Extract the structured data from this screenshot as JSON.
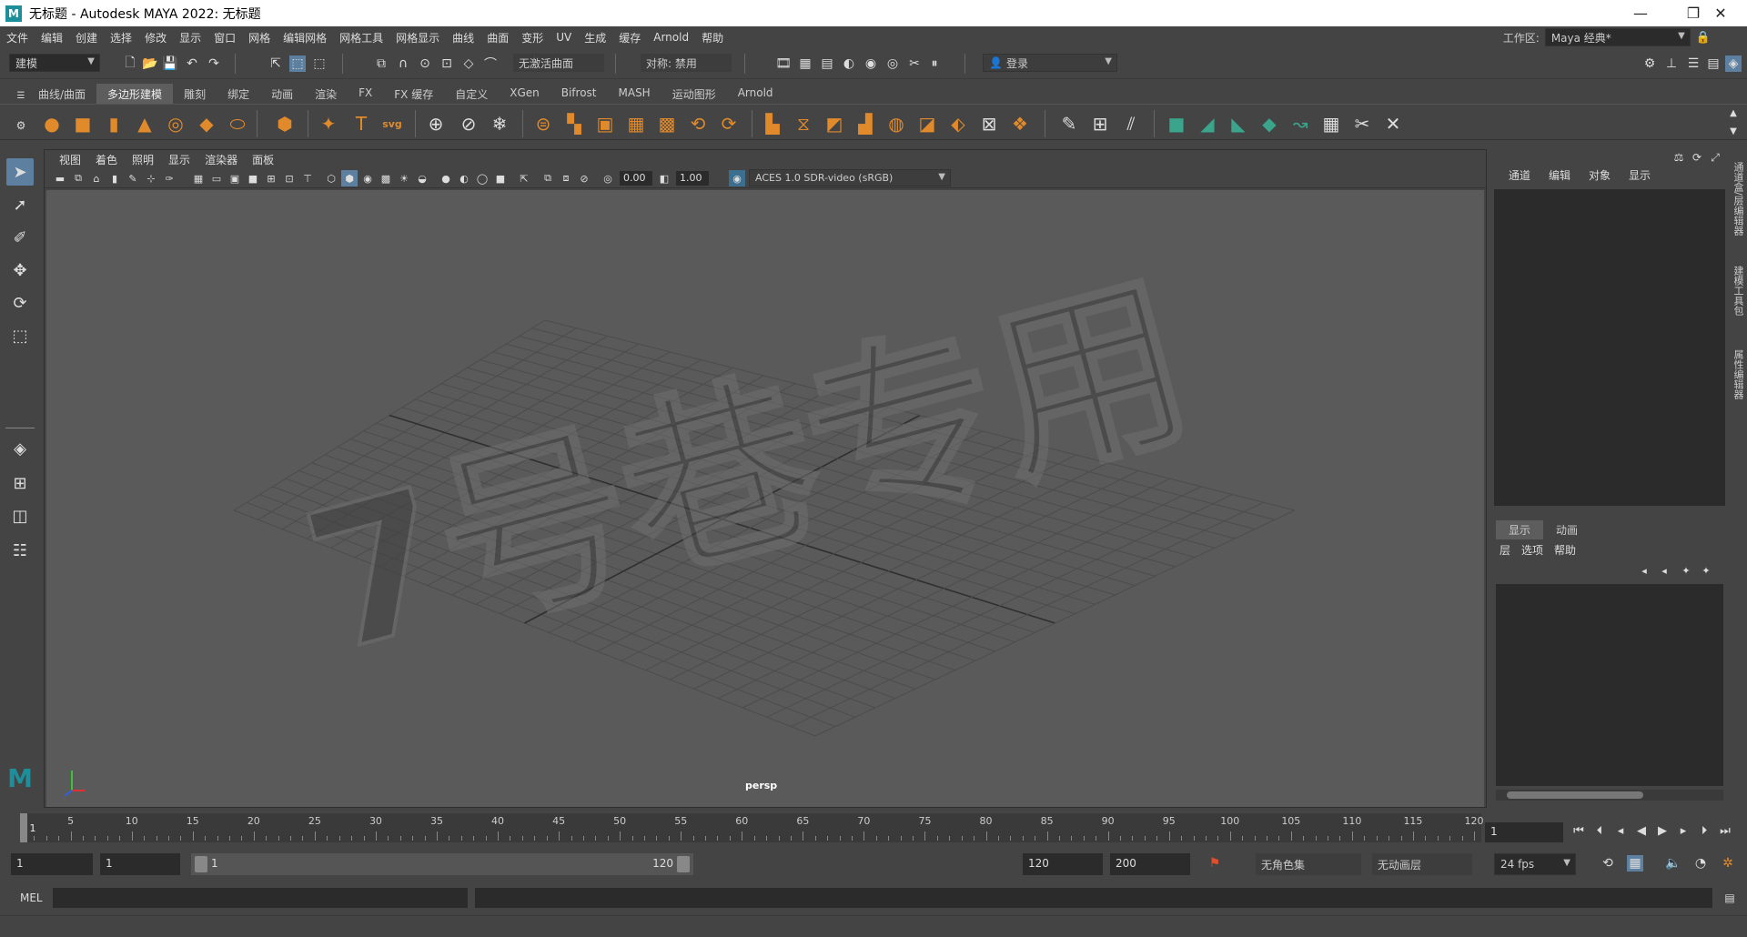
{
  "app": {
    "title": "无标题 - Autodesk MAYA 2022: 无标题",
    "logo_letter": "M"
  },
  "menu": [
    "文件",
    "编辑",
    "创建",
    "选择",
    "修改",
    "显示",
    "窗口",
    "网格",
    "编辑网格",
    "网格工具",
    "网格显示",
    "曲线",
    "曲面",
    "变形",
    "UV",
    "生成",
    "缓存",
    "Arnold",
    "帮助"
  ],
  "workspace": {
    "label": "工作区:",
    "value": "Maya 经典*"
  },
  "statusline": {
    "mode": "建模",
    "live_surface": "无激活曲面",
    "symmetry": "对称: 禁用",
    "login": "登录"
  },
  "shelf_tabs": [
    "曲线/曲面",
    "多边形建模",
    "雕刻",
    "绑定",
    "动画",
    "渲染",
    "FX",
    "FX 缓存",
    "自定义",
    "XGen",
    "Bifrost",
    "MASH",
    "运动图形",
    "Arnold"
  ],
  "shelf_active": "多边形建模",
  "viewport": {
    "menu": [
      "视图",
      "着色",
      "照明",
      "显示",
      "渲染器",
      "面板"
    ],
    "exposure": "0.00",
    "gamma": "1.00",
    "colorspace": "ACES 1.0 SDR-video (sRGB)",
    "camera": "persp",
    "watermark": "7号巷专用"
  },
  "channelbox": {
    "menu": [
      "通道",
      "编辑",
      "对象",
      "显示"
    ]
  },
  "layers": {
    "tabs": [
      "显示",
      "动画"
    ],
    "active_tab": "显示",
    "menu": [
      "层",
      "选项",
      "帮助"
    ]
  },
  "side_tabs": [
    "通道盒/层编辑器",
    "建模工具包",
    "属性编辑器"
  ],
  "timeline": {
    "ticks": [
      "1",
      "5",
      "10",
      "15",
      "20",
      "25",
      "30",
      "35",
      "40",
      "45",
      "50",
      "55",
      "60",
      "65",
      "70",
      "75",
      "80",
      "85",
      "90",
      "95",
      "100",
      "105",
      "110",
      "115",
      "120"
    ],
    "current_frame": "1"
  },
  "range": {
    "start": "1",
    "playback_start": "1",
    "slider_start": "1",
    "slider_end": "120",
    "playback_end": "120",
    "end": "200",
    "character_set": "无角色集",
    "anim_layer": "无动画层",
    "fps": "24 fps"
  },
  "cmdline": {
    "label": "MEL"
  },
  "colors": {
    "accent": "#1d8f9b",
    "shelf_orange": "#e08a2c",
    "shelf_green": "#3aa58a"
  }
}
